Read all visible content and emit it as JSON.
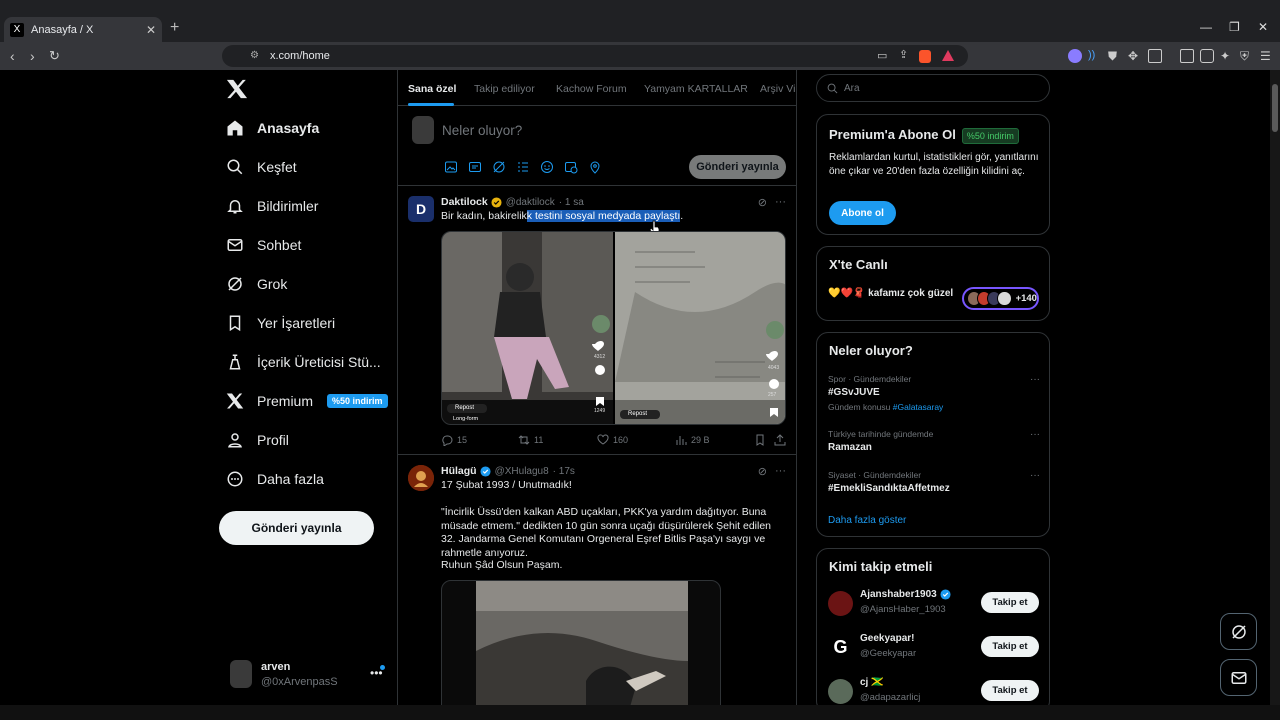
{
  "browser": {
    "tab_title": "Anasayfa / X",
    "tab_favicon": "X",
    "url": "x.com/home"
  },
  "sidebar": {
    "items": [
      {
        "label": "Anasayfa",
        "icon": "home-icon"
      },
      {
        "label": "Keşfet",
        "icon": "search-icon"
      },
      {
        "label": "Bildirimler",
        "icon": "bell-icon"
      },
      {
        "label": "Sohbet",
        "icon": "mail-icon"
      },
      {
        "label": "Grok",
        "icon": "grok-icon"
      },
      {
        "label": "Yer İşaretleri",
        "icon": "bookmark-icon"
      },
      {
        "label": "İçerik Üreticisi Stü...",
        "icon": "creator-studio-icon"
      },
      {
        "label": "Premium",
        "icon": "x-logo-icon"
      },
      {
        "label": "Profil",
        "icon": "person-icon"
      },
      {
        "label": "Daha fazla",
        "icon": "more-circle-icon"
      }
    ],
    "premium_badge": "%50 indirim",
    "post_button": "Gönderi yayınla",
    "account": {
      "name": "arven",
      "handle": "@0xArvenpasS"
    }
  },
  "feed": {
    "tabs": [
      "Sana özel",
      "Takip ediliyor",
      "Kachow Forum",
      "Yamyam KARTALLAR",
      "Arşiv Vi"
    ],
    "compose_placeholder": "Neler oluyor?",
    "compose_button": "Gönderi yayınla",
    "tweets": [
      {
        "name": "Daktilock",
        "handle": "@daktilock",
        "time": "· 1 sa",
        "text_before": "Bir kadın, bakirelik",
        "text_highlight": "k testini sosyal medyada paylaştı",
        "text_after": ".",
        "media_left_labels": {
          "repost": "Repost",
          "long": "Long-form",
          "c1": "4312",
          "c2": "1249",
          "c3": "1249"
        },
        "media_right_labels": {
          "repost": "Repost",
          "c1": "4043",
          "c2": "257"
        },
        "replies": "15",
        "reposts": "11",
        "likes": "160",
        "views": "29 B"
      },
      {
        "name": "Hülagü",
        "handle": "@XHulagu8",
        "time": "· 17s",
        "p1": "17 Şubat 1993 / Unutmadık!",
        "p2": "\"İncirlik Üssü'den kalkan ABD uçakları, PKK'ya yardım dağıtıyor. Buna müsade etmem.\" dedikten 10 gün sonra uçağı düşürülerek Şehit edilen 32. Jandarma Genel Komutanı Orgeneral Eşref Bitlis Paşa'yı saygı ve rahmetle anıyoruz.",
        "p3": "Ruhun Şâd Olsun Paşam."
      }
    ]
  },
  "right": {
    "search_placeholder": "Ara",
    "premium": {
      "title": "Premium'a Abone Ol",
      "tag": "%50 indirim",
      "desc": "Reklamlardan kurtul, istatistikleri gör, yanıtlarını öne çıkar ve 20'den fazla özelliğin kilidini aç.",
      "button": "Abone ol"
    },
    "live": {
      "title": "X'te Canlı",
      "emoji": "💛❤️🧣",
      "text": "kafamız çok güzel",
      "count": "+140"
    },
    "trends": {
      "title": "Neler oluyor?",
      "items": [
        {
          "category": "Spor · Gündemdekiler",
          "topic": "#GSvJUVE",
          "sub_prefix": "Gündem konusu",
          "sub_link": "#Galatasaray"
        },
        {
          "category": "Türkiye tarihinde gündemde",
          "topic": "Ramazan"
        },
        {
          "category": "Siyaset · Gündemdekiler",
          "topic": "#EmekliSandıktaAffetmez"
        }
      ],
      "show_more": "Daha fazla göster"
    },
    "who_to_follow": {
      "title": "Kimi takip etmeli",
      "items": [
        {
          "name": "Ajanshaber1903",
          "handle": "@AjansHaber_1903",
          "button": "Takip et"
        },
        {
          "name": "Geekyapar!",
          "handle": "@Geekyapar",
          "button": "Takip et"
        },
        {
          "name": "cj 🇯🇲",
          "handle": "@adapazarlicj",
          "button": "Takip et"
        }
      ]
    }
  },
  "colors": {
    "accent": "#1d9bf0",
    "bg": "#000000",
    "border": "#2f3336",
    "muted": "#71767b"
  }
}
